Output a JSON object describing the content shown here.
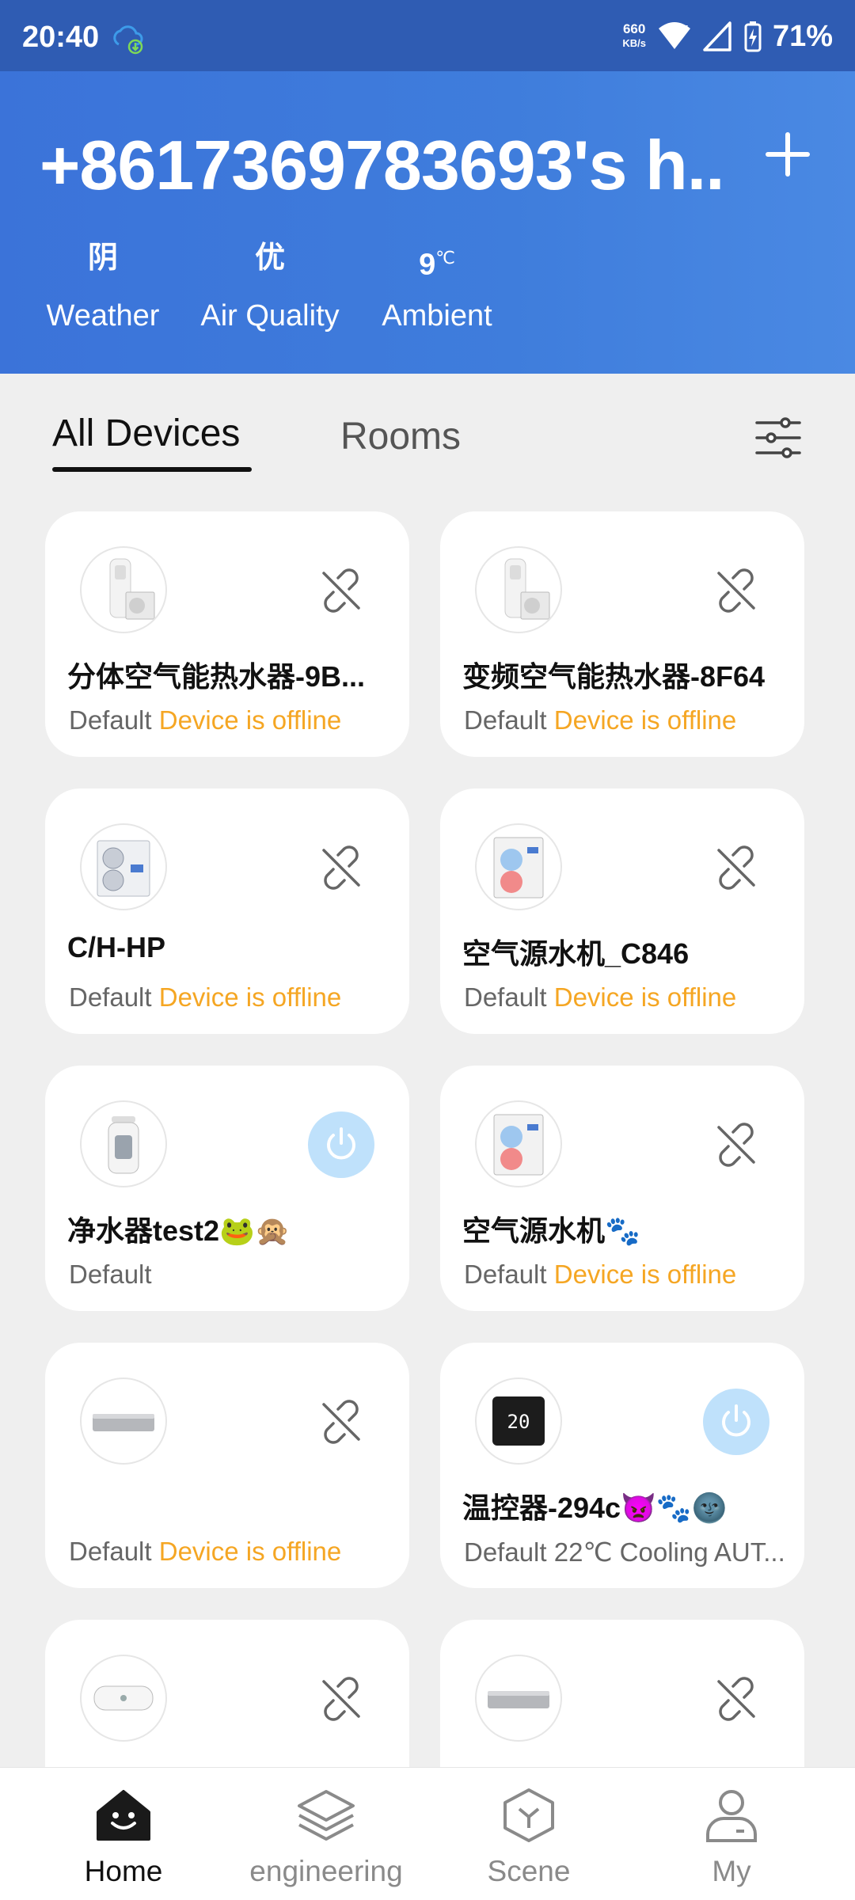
{
  "status_bar": {
    "time": "20:40",
    "net_speed_value": "660",
    "net_speed_unit": "KB/s",
    "battery": "71%"
  },
  "header": {
    "title": "+8617369783693's h..",
    "weather": {
      "value": "阴",
      "label": "Weather"
    },
    "air_quality": {
      "value": "优",
      "label": "Air Quality"
    },
    "ambient": {
      "value": "9",
      "unit": "℃",
      "label": "Ambient"
    }
  },
  "tabs": {
    "all_devices": "All Devices",
    "rooms": "Rooms"
  },
  "devices": [
    {
      "name": "分体空气能热水器-9B...",
      "room": "Default",
      "status": "Device is offline",
      "state": "offline"
    },
    {
      "name": "变频空气能热水器-8F64",
      "room": "Default",
      "status": "Device is offline",
      "state": "offline"
    },
    {
      "name": "C/H-HP",
      "room": "Default",
      "status": "Device is offline",
      "state": "offline"
    },
    {
      "name": "空气源水机_C846",
      "room": "Default",
      "status": "Device is offline",
      "state": "offline"
    },
    {
      "name": "净水器test2🐸🙊",
      "room": "Default",
      "status": "",
      "state": "online"
    },
    {
      "name": "空气源水机🐾",
      "room": "Default",
      "status": "Device is offline",
      "state": "offline"
    },
    {
      "name": "",
      "room": "Default",
      "status": "Device is offline",
      "state": "offline"
    },
    {
      "name": "温控器-294c👿🐾🌚",
      "room": "Default",
      "status": "22℃ Cooling AUT...",
      "state": "online"
    },
    {
      "name": "",
      "room": "",
      "status": "",
      "state": "offline"
    },
    {
      "name": "",
      "room": "",
      "status": "",
      "state": "offline"
    }
  ],
  "nav": {
    "home": "Home",
    "engineering": "engineering",
    "scene": "Scene",
    "my": "My"
  },
  "colors": {
    "header_blue": "#3f7ddc",
    "offline_orange": "#f5a623",
    "power_blue": "#bfe1fb"
  }
}
